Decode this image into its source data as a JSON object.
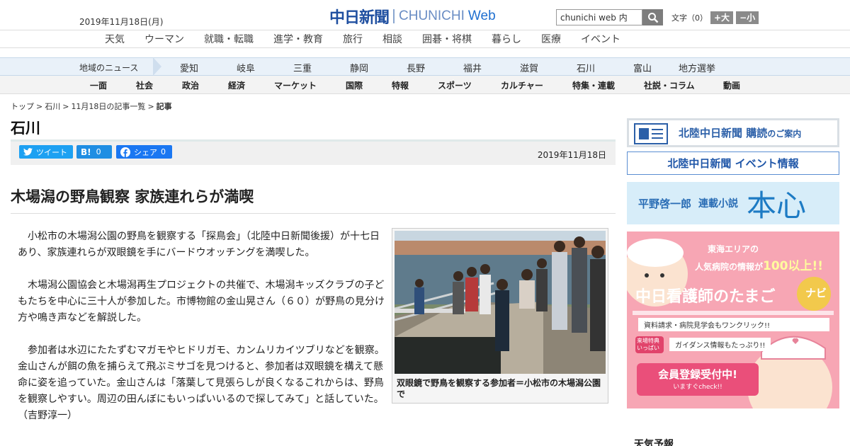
{
  "header": {
    "date": "2019年11月18日(月)",
    "logo_kanji": "中日新聞",
    "logo_en": "CHUNICHI",
    "logo_web": "Web",
    "search_value": "chunichi web 内",
    "fontsize_label": "文字（0）",
    "fontsize_up": "+大",
    "fontsize_down": "−小"
  },
  "global_nav": [
    "天気",
    "ウーマン",
    "就職・転職",
    "進学・教育",
    "旅行",
    "相談",
    "囲碁・将棋",
    "暮らし",
    "医療",
    "イベント"
  ],
  "region_nav": {
    "label": "地域のニュース",
    "items": [
      "愛知",
      "岐阜",
      "三重",
      "静岡",
      "長野",
      "福井",
      "滋賀",
      "石川",
      "富山",
      "地方選挙"
    ]
  },
  "category_nav": [
    "一面",
    "社会",
    "政治",
    "経済",
    "マーケット",
    "国際",
    "特報",
    "スポーツ",
    "カルチャー",
    "特集・連載",
    "社説・コラム",
    "動画"
  ],
  "breadcrumb": [
    "トップ",
    "石川",
    "11月18日の記事一覧",
    "記事"
  ],
  "section_title": "石川",
  "share": {
    "tweet": "ツイート",
    "hatena": "B!",
    "hatena_count": "0",
    "facebook": "シェア",
    "facebook_count": "0"
  },
  "pub_date": "2019年11月18日",
  "headline": "木場潟の野鳥観察 家族連れらが満喫",
  "body": [
    "小松市の木場潟公園の野鳥を観察する「探鳥会」（北陸中日新聞後援）が十七日あり、家族連れらが双眼鏡を手にバードウオッチングを満喫した。",
    "木場潟公園協会と木場潟再生プロジェクトの共催で、木場潟キッズクラブの子どもたちを中心に三十人が参加した。市博物館の金山晃さん（６０）が野鳥の見分け方や鳴き声などを解説した。",
    "参加者は水辺にたたずむマガモやヒドリガモ、カンムリカイツブリなどを観察。金山さんが餌の魚を捕らえて飛ぶミサゴを見つけると、参加者は双眼鏡を構えて懸命に姿を追っていた。金山さんは「落葉して見張らしが良くなるこれからは、野鳥を観察しやすい。周辺の田んぼにもいっぱいいるので探してみて」と話していた。（吉野淳一）"
  ],
  "photo_caption": "双眼鏡で野鳥を観察する参加者＝小松市の木場潟公園で",
  "sidebar": {
    "ad1_main": "北陸中日新聞 購読",
    "ad1_sub": "のご案内",
    "ad2": "北陸中日新聞 イベント情報",
    "ad3_author": "平野啓一郎",
    "ad3_series": "連載小説",
    "ad3_title": "本心",
    "ad4_line1": "東海エリアの",
    "ad4_line2": "人気病院の情報が",
    "ad4_highlight": "100以上!!",
    "ad4_title": "中日看護師のたまご",
    "ad4_title_suffix": "ナビ",
    "ad4_bullet1": "資料請求・病院見学会もワンクリック!!",
    "ad4_bullet2": "ガイダンス情報もたっぷり!!",
    "ad4_badge": "来場特典いっぱい",
    "ad4_cta": "会員登録受付中!",
    "ad4_cta_sub": "いますぐcheck!!",
    "weather_heading": "天気予報"
  },
  "colors": {
    "brand_blue": "#1f4fa0",
    "twitter": "#1da1f2",
    "facebook": "#1a77f2",
    "region_bar": "#e9f1f9",
    "ad_pink": "#f7a6b4"
  }
}
